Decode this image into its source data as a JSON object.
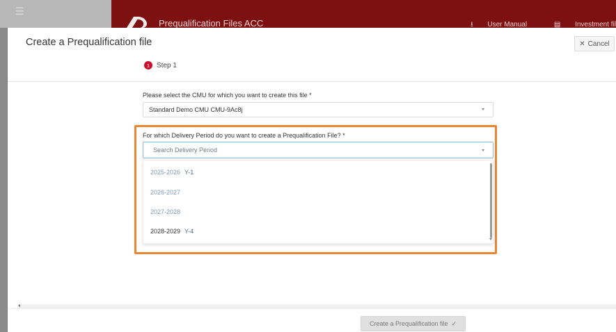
{
  "background": {
    "menu_icon": "☰",
    "app_title": "Prequalification Files ACC",
    "links": [
      {
        "icon": "download-icon",
        "glyph": "⭳",
        "label": "User Manual"
      },
      {
        "icon": "file-icon",
        "glyph": "▤",
        "label": "Investment fil"
      }
    ],
    "brand_color": "#7d1111"
  },
  "modal": {
    "title": "Create a Prequalification file",
    "cancel": {
      "icon": "close-icon",
      "glyph": "✕",
      "label": "Cancel"
    },
    "step": {
      "number": "1",
      "label": "Step 1"
    },
    "cmu_field": {
      "label": "Please select the CMU for which you want to create this file *",
      "value": "Standard Demo CMU CMU-9Ac8j"
    },
    "period_field": {
      "label": "For which Delivery Period do you want to create a Prequalification File? *",
      "placeholder": "Search Delivery Period",
      "options": [
        {
          "period": "2025-2026",
          "tag": "Y-1",
          "disabled": true
        },
        {
          "period": "2026-2027",
          "tag": "",
          "disabled": true
        },
        {
          "period": "2027-2028",
          "tag": "",
          "disabled": true
        },
        {
          "period": "2028-2029",
          "tag": "Y-4",
          "disabled": false
        }
      ]
    },
    "submit": {
      "label": "Create a Prequalification file",
      "icon": "check-icon",
      "glyph": "✓"
    }
  },
  "colors": {
    "highlight": "#ea8531",
    "step_badge": "#c8102e"
  }
}
